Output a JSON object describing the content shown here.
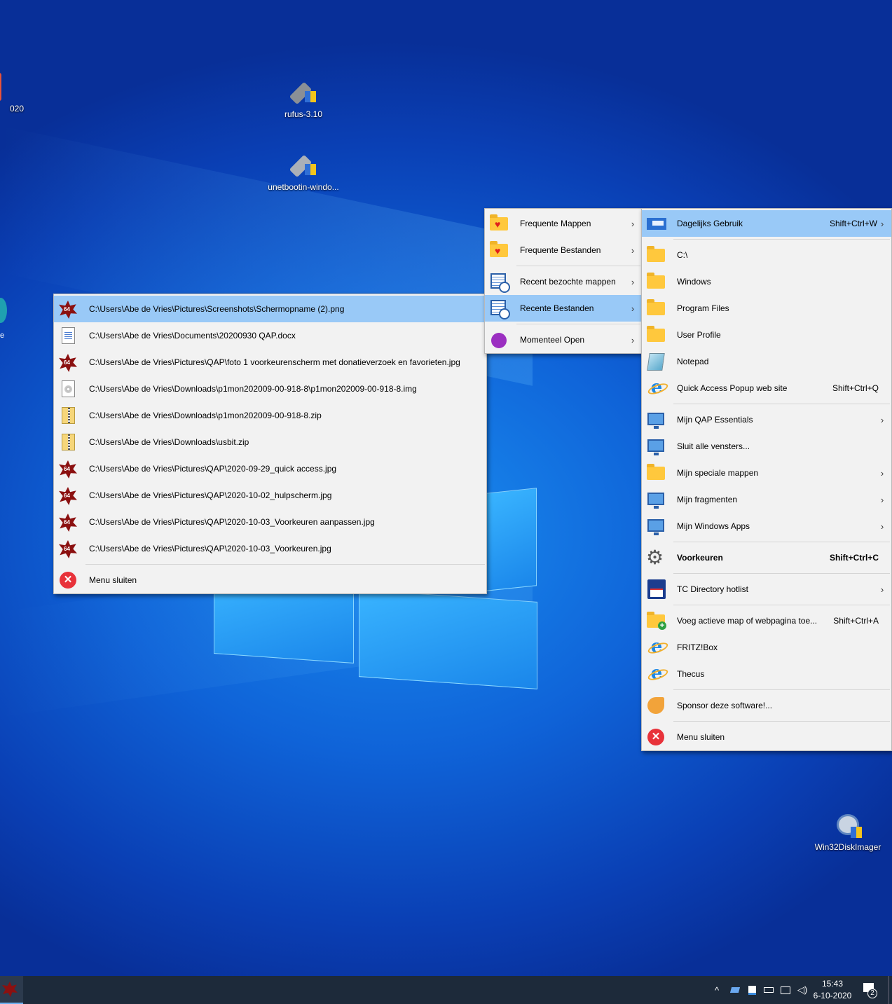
{
  "desktop_icons": [
    {
      "label": "020",
      "icon": "app-icon"
    },
    {
      "label": "rufus-3.10",
      "icon": "usb-drive-icon"
    },
    {
      "label": "unetbootin-windo...",
      "icon": "usb-drive-icon"
    },
    {
      "label": "Win32DiskImager",
      "icon": "disk-imager-icon"
    },
    {
      "label": "e",
      "icon": "app-icon"
    }
  ],
  "left_menu": {
    "items": [
      {
        "label": "C:\\Users\\Abe de Vries\\Pictures\\Screenshots\\Schermopname (2).png",
        "icon": "qap",
        "highlight": true
      },
      {
        "label": "C:\\Users\\Abe de Vries\\Documents\\20200930 QAP.docx",
        "icon": "doc"
      },
      {
        "label": "C:\\Users\\Abe de Vries\\Pictures\\QAP\\foto 1 voorkeurenscherm met donatieverzoek en favorieten.jpg",
        "icon": "qap"
      },
      {
        "label": "C:\\Users\\Abe de Vries\\Downloads\\p1mon202009-00-918-8\\p1mon202009-00-918-8.img",
        "icon": "disc"
      },
      {
        "label": "C:\\Users\\Abe de Vries\\Downloads\\p1mon202009-00-918-8.zip",
        "icon": "zip"
      },
      {
        "label": "C:\\Users\\Abe de Vries\\Downloads\\usbit.zip",
        "icon": "zip"
      },
      {
        "label": "C:\\Users\\Abe de Vries\\Pictures\\QAP\\2020-09-29_quick access.jpg",
        "icon": "qap"
      },
      {
        "label": "C:\\Users\\Abe de Vries\\Pictures\\QAP\\2020-10-02_hulpscherm.jpg",
        "icon": "qap"
      },
      {
        "label": "C:\\Users\\Abe de Vries\\Pictures\\QAP\\2020-10-03_Voorkeuren aanpassen.jpg",
        "icon": "qap"
      },
      {
        "label": "C:\\Users\\Abe de Vries\\Pictures\\QAP\\2020-10-03_Voorkeuren.jpg",
        "icon": "qap"
      },
      {
        "sep": true
      },
      {
        "label": "Menu sluiten",
        "icon": "close"
      }
    ]
  },
  "middle_menu": {
    "items": [
      {
        "label": "Frequente Mappen",
        "icon": "heartfolder",
        "submenu": true
      },
      {
        "label": "Frequente Bestanden",
        "icon": "heartfolder",
        "submenu": true
      },
      {
        "sep": true
      },
      {
        "label": "Recent bezochte mappen",
        "icon": "recent",
        "submenu": true
      },
      {
        "label": "Recente Bestanden",
        "icon": "recent",
        "submenu": true,
        "highlight": true
      },
      {
        "sep": true
      },
      {
        "label": "Momenteel Open",
        "icon": "purple",
        "submenu": true
      }
    ]
  },
  "right_menu": {
    "items": [
      {
        "label": "Dagelijks Gebruik",
        "shortcut": "Shift+Ctrl+W",
        "icon": "daily",
        "submenu": true,
        "highlight": true
      },
      {
        "sep": true
      },
      {
        "label": "C:\\",
        "icon": "folder"
      },
      {
        "label": "Windows",
        "icon": "folder"
      },
      {
        "label": "Program Files",
        "icon": "folder"
      },
      {
        "label": "User Profile",
        "icon": "folder"
      },
      {
        "label": "Notepad",
        "icon": "notepad"
      },
      {
        "label": "Quick Access Popup web site",
        "shortcut": "Shift+Ctrl+Q",
        "icon": "ie"
      },
      {
        "sep": true
      },
      {
        "label": "Mijn QAP Essentials",
        "icon": "monitor",
        "submenu": true
      },
      {
        "label": "Sluit alle vensters...",
        "icon": "monitor"
      },
      {
        "label": "Mijn speciale mappen",
        "icon": "folder",
        "submenu": true
      },
      {
        "label": "Mijn fragmenten",
        "icon": "monitor",
        "submenu": true
      },
      {
        "label": "Mijn Windows Apps",
        "icon": "monitor",
        "submenu": true
      },
      {
        "sep": true
      },
      {
        "label": "Voorkeuren",
        "shortcut": "Shift+Ctrl+C",
        "icon": "gear",
        "bold": true
      },
      {
        "sep": true
      },
      {
        "label": "TC Directory hotlist",
        "icon": "floppy",
        "submenu": true
      },
      {
        "sep": true
      },
      {
        "label": "Voeg actieve map of webpagina toe...",
        "shortcut": "Shift+Ctrl+A",
        "icon": "folderplus"
      },
      {
        "label": "FRITZ!Box",
        "icon": "ie"
      },
      {
        "label": "Thecus",
        "icon": "ie"
      },
      {
        "sep": true
      },
      {
        "label": "Sponsor deze software!...",
        "icon": "sponsor"
      },
      {
        "sep": true
      },
      {
        "label": "Menu sluiten",
        "icon": "close"
      }
    ]
  },
  "taskbar": {
    "time": "15:43",
    "date": "6-10-2020",
    "notification_count": "2",
    "chevron": "^"
  },
  "colors": {
    "highlight": "#99c9f7",
    "menu_bg": "#f2f2f2",
    "taskbar": "#1d2a3a"
  }
}
